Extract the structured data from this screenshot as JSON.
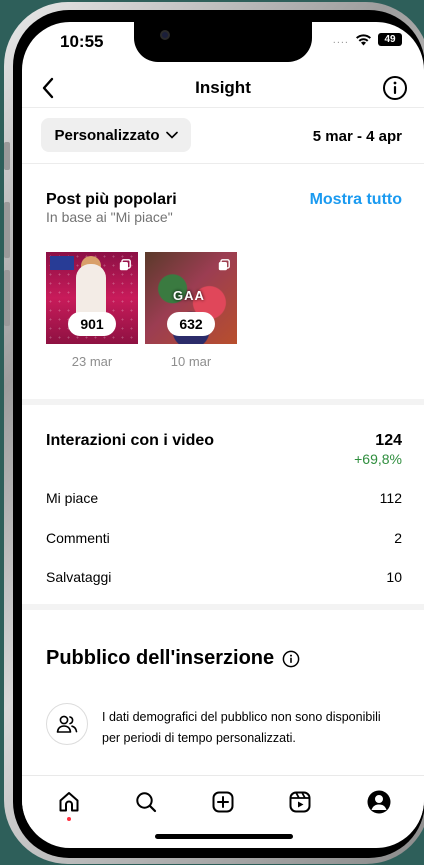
{
  "status_bar": {
    "time": "10:55",
    "signal": "....",
    "battery": "49"
  },
  "header": {
    "title": "Insight",
    "back_icon": "chevron-left-icon",
    "info_icon": "info-icon"
  },
  "filter": {
    "period_label": "Personalizzato",
    "period_icon": "chevron-down-icon",
    "date_range": "5 mar - 4 apr"
  },
  "top_posts": {
    "title": "Post più popolari",
    "subtitle": "In base ai \"Mi piace\"",
    "show_all_label": "Mostra tutto",
    "show_all_color": "#1a9af0",
    "posts": [
      {
        "count": "901",
        "date": "23 mar"
      },
      {
        "count": "632",
        "date": "10 mar",
        "caption": "GAA"
      }
    ]
  },
  "video_interactions": {
    "title": "Interazioni con i video",
    "total": "124",
    "change": "+69,8%",
    "change_color": "#2f8e3e",
    "rows": [
      {
        "label": "Mi piace",
        "value": "112"
      },
      {
        "label": "Commenti",
        "value": "2"
      },
      {
        "label": "Salvataggi",
        "value": "10"
      }
    ]
  },
  "audience": {
    "title": "Pubblico dell'inserzione",
    "message": "I dati demografici del pubblico non sono disponibili per periodi di tempo personalizzati.",
    "icon": "people-icon"
  },
  "bottom_nav": {
    "tabs": [
      "home-icon",
      "search-icon",
      "create-icon",
      "reels-icon",
      "profile-icon"
    ],
    "active": "home-icon",
    "badge_color": "#ff3040"
  }
}
